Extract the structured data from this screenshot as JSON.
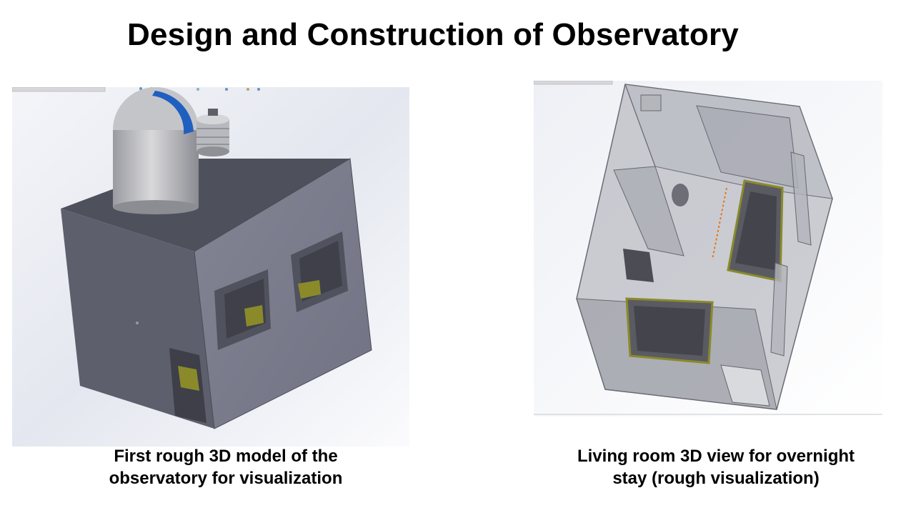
{
  "slide": {
    "title": "Design and Construction of Observatory"
  },
  "figures": [
    {
      "caption_line1": "First rough 3D model of the",
      "caption_line2": "observatory for visualization"
    },
    {
      "caption_line1": "Living room 3D view for overnight",
      "caption_line2": "stay (rough visualization)"
    }
  ],
  "colors": {
    "wall_front": "#7e7f8f",
    "wall_side": "#5e606e",
    "roof": "#4c4e5a",
    "dome_blue": "#1f5fc0",
    "bed_yellow": "#8a8a2a",
    "glass": "#9fa0aa"
  }
}
